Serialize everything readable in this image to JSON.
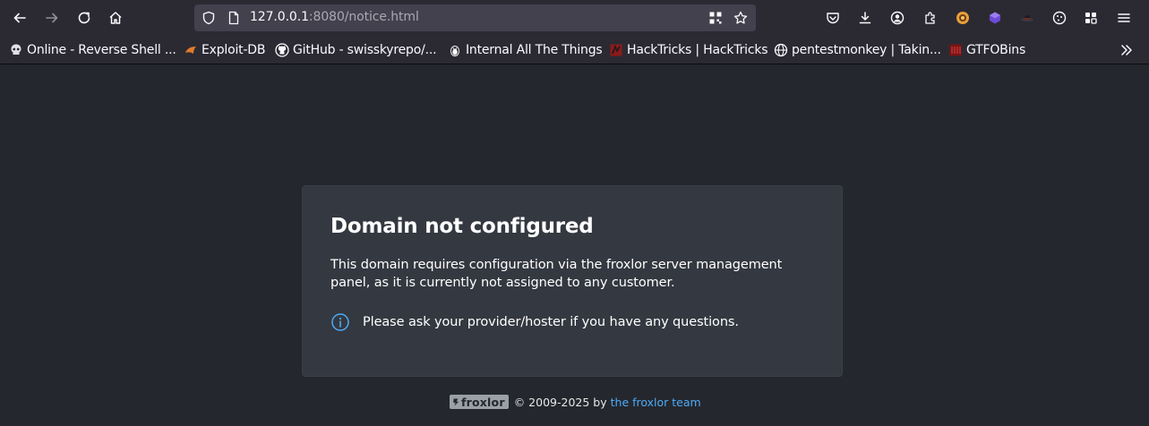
{
  "browser": {
    "url_host": "127.0.0.1",
    "url_rest": ":8080/notice.html",
    "bookmarks": [
      {
        "label": "Online - Reverse Shell ...",
        "icon": "skull-icon"
      },
      {
        "label": "Exploit-DB",
        "icon": "exploit-db-icon"
      },
      {
        "label": "GitHub - swisskyrepo/...",
        "icon": "github-icon"
      },
      {
        "label": "Internal All The Things",
        "icon": "penguin-icon"
      },
      {
        "label": "HackTricks | HackTricks",
        "icon": "hacktricks-icon"
      },
      {
        "label": "pentestmonkey | Takin...",
        "icon": "globe-icon"
      },
      {
        "label": "GTFOBins",
        "icon": "gtfobins-icon"
      }
    ]
  },
  "notice": {
    "title": "Domain not configured",
    "text": "This domain requires configuration via the froxlor server management panel, as it is currently not assigned to any customer.",
    "info": "Please ask your provider/hoster if you have any questions."
  },
  "footer": {
    "logo": "froxlor",
    "copyright": "© 2009-2025 by",
    "link": "the froxlor team"
  },
  "colors": {
    "page_bg": "#24272d",
    "card_bg": "#343840",
    "link": "#4dabf7",
    "toolbar_bg": "#2b2a33"
  }
}
